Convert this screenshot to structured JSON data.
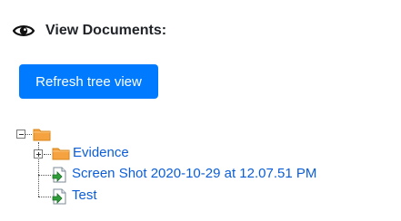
{
  "header": {
    "icon": "eye-icon",
    "title": "View Documents:"
  },
  "toolbar": {
    "refresh_label": "Refresh tree view"
  },
  "colors": {
    "primary": "#007bff",
    "link": "#0b5ed7",
    "folder": "#f39c34"
  },
  "tree": {
    "root": {
      "icon": "folder-icon",
      "expanded": true
    },
    "children": [
      {
        "label": "Evidence",
        "icon": "folder-icon",
        "expanded": false
      },
      {
        "label": "Screen Shot 2020-10-29 at 12.07.51 PM",
        "icon": "document-icon"
      },
      {
        "label": "Test",
        "icon": "document-icon"
      }
    ]
  }
}
